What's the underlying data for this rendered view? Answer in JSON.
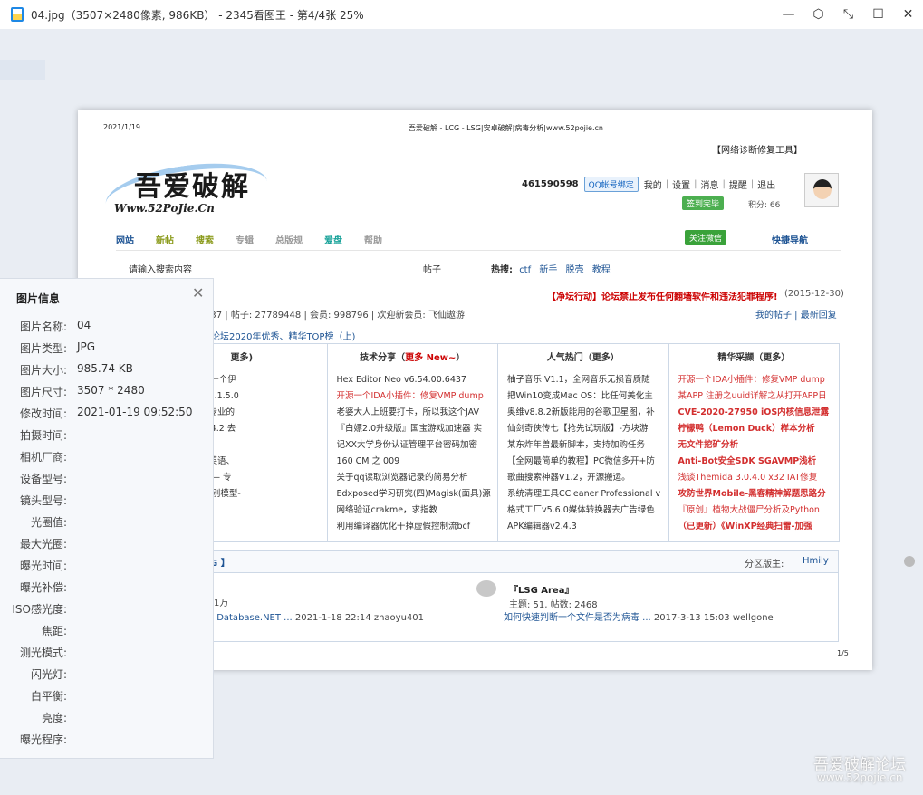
{
  "window": {
    "title": "04.jpg（3507×2480像素, 986KB） - 2345看图王 - 第4/4张 25%",
    "controls": [
      "—",
      "⬡",
      "⤡",
      "☐",
      "✕"
    ]
  },
  "doc": {
    "date": "2021/1/19",
    "header_title": "吾爱破解 - LCG - LSG|安卓破解|病毒分析|www.52pojie.cn",
    "diag_link": "【网络诊断修复工具】",
    "logo_main": "吾爱破解",
    "logo_sub": "Www.52PoJie.Cn",
    "user": {
      "uid": "461590598",
      "qq_bind": "QQ帐号绑定",
      "links": [
        "我的",
        "设置",
        "消息",
        "提醒",
        "退出"
      ],
      "signin": "签到完毕",
      "points": "积分: 66"
    },
    "nav": [
      {
        "label": "网站",
        "color": "#1e5494"
      },
      {
        "label": "新帖",
        "color": "#8a9a1a"
      },
      {
        "label": "搜索",
        "color": "#8a9a1a"
      },
      {
        "label": "专辑",
        "color": "#999999"
      },
      {
        "label": "总版规",
        "color": "#999999"
      },
      {
        "label": "爱盘",
        "color": "#1aa39a"
      },
      {
        "label": "帮助",
        "color": "#999999"
      }
    ],
    "wechat": "关注微信",
    "quicknav": "快捷导航",
    "search": {
      "placeholder": "请输入搜索内容",
      "type": "帖子",
      "hot_label": "热搜:",
      "hot": [
        "ctf",
        "新手",
        "脱壳",
        "教程"
      ]
    },
    "notice": "【净坛行动】论坛禁止发布任何翻墙软件和违法犯罪程序!",
    "notice_date": "(2015-12-30)",
    "stats": "437 | 帖子: 27789448 | 会员: 998796 | 欢迎新会员: 飞仙遨游",
    "my_links": "我的帖子 | 最新回复",
    "top_link": "论坛2020年优秀、精华TOP榜（上)",
    "columns": [
      {
        "head": "更多)",
        "head_more": "",
        "items": [
          {
            "t": "EDEN】(另一个伊",
            "c": ""
          },
          {
            "t": "",
            "c": ""
          },
          {
            "t": "方客户端 V4.1.5.0",
            "c": ""
          },
          {
            "t": "磨皮，超越专业的",
            "c": ""
          },
          {
            "t": "电脑版 6.4.4.2 去",
            "c": ""
          },
          {
            "t": "",
            "c": ""
          },
          {
            "t": "4.00.6437",
            "c": ""
          },
          {
            "t": "去广告——英语、",
            "c": ""
          },
          {
            "t": "去广告版 —— 专",
            "c": ""
          },
          {
            "t": "权器-本地识别模型-",
            "c": ""
          }
        ]
      },
      {
        "head": "技术分享（",
        "head_more": "更多 New~",
        "items": [
          {
            "t": "Hex Editor Neo v6.54.00.6437",
            "c": ""
          },
          {
            "t": "开源一个IDA小插件：修复VMP dump",
            "c": "red"
          },
          {
            "t": "老婆大人上班要打卡，所以我这个JAV",
            "c": ""
          },
          {
            "t": "『白嫖2.0升级版』国宝游戏加速器 实",
            "c": ""
          },
          {
            "t": "记XX大学身份认证管理平台密码加密",
            "c": ""
          },
          {
            "t": "160 CM 之 009",
            "c": ""
          },
          {
            "t": "关于qq读取浏览器记录的简易分析",
            "c": ""
          },
          {
            "t": "Edxposed学习研究(四)Magisk(面具)源",
            "c": ""
          },
          {
            "t": "网络验证crakme，求指教",
            "c": ""
          },
          {
            "t": "利用编译器优化干掉虚假控制流bcf",
            "c": ""
          }
        ]
      },
      {
        "head": "人气热门（更多）",
        "head_more": "",
        "items": [
          {
            "t": "柚子音乐 V1.1，全网音乐无损音质随",
            "c": ""
          },
          {
            "t": "把Win10变成Mac OS：比任何美化主",
            "c": ""
          },
          {
            "t": "奥维v8.8.2新版能用的谷歌卫星图，补",
            "c": ""
          },
          {
            "t": "仙剑奇侠传七【抢先试玩版】-方块游",
            "c": ""
          },
          {
            "t": "某东炸年兽最新脚本，支持加购任务",
            "c": ""
          },
          {
            "t": "【全网最简单的教程】PC微信多开+防",
            "c": ""
          },
          {
            "t": "歌曲搜索神器V1.2，开源搬运。",
            "c": ""
          },
          {
            "t": "系统清理工具CCleaner Professional v",
            "c": ""
          },
          {
            "t": "格式工厂v5.6.0媒体转换器去广告绿色",
            "c": ""
          },
          {
            "t": "APK编辑器v2.4.3",
            "c": ""
          }
        ]
      },
      {
        "head": "精华采撷（更多）",
        "head_more": "",
        "items": [
          {
            "t": "开源一个IDA小插件：修复VMP dump",
            "c": "red"
          },
          {
            "t": "某APP 注册之uuid详解之从打开APP日",
            "c": "red"
          },
          {
            "t": "CVE-2020-27950 iOS内核信息泄露",
            "c": "red bold"
          },
          {
            "t": "柠檬鸭（Lemon Duck）样本分析",
            "c": "red bold"
          },
          {
            "t": "无文件挖矿分析",
            "c": "red bold"
          },
          {
            "t": "Anti-Bot安全SDK SGAVMP浅析",
            "c": "red bold"
          },
          {
            "t": "浅谈Themida 3.0.4.0 x32 IAT修复",
            "c": "red"
          },
          {
            "t": "攻防世界Mobile-黑客精神解题思路分",
            "c": "red bold"
          },
          {
            "t": "『原创』植物大战僵尸分析及Python",
            "c": "red"
          },
          {
            "t": "（已更新）《WinXP经典扫雷-加强",
            "c": "red bold"
          }
        ]
      }
    ],
    "lsg": {
      "title": "G 】",
      "mod_label": "分区版主:",
      "mod_name": "Hmily",
      "wan": "1万",
      "last_left_prefix": "：",
      "last_left_link": "Database.NET ...",
      "last_left_meta": "2021-1-18 22:14 zhaoyu401",
      "area_name": "『LSG Area』",
      "area_stats": "主题: 51, 帖数: 2468",
      "area_last_link": "如何快速判断一个文件是否为病毒 ...",
      "area_last_meta": "2017-3-13 15:03 wellgone"
    },
    "page_num": "1/5"
  },
  "info_panel": {
    "title": "图片信息",
    "rows": [
      {
        "label": "图片名称:",
        "value": "04"
      },
      {
        "label": "图片类型:",
        "value": "JPG"
      },
      {
        "label": "图片大小:",
        "value": "985.74 KB"
      },
      {
        "label": "图片尺寸:",
        "value": "3507 * 2480"
      },
      {
        "label": "修改时间:",
        "value": "2021-01-19 09:52:50"
      },
      {
        "label": "拍摄时间:",
        "value": ""
      },
      {
        "label": "相机厂商:",
        "value": ""
      },
      {
        "label": "设备型号:",
        "value": ""
      },
      {
        "label": "镜头型号:",
        "value": ""
      },
      {
        "label": "光圈值:",
        "value": ""
      },
      {
        "label": "最大光圈:",
        "value": ""
      },
      {
        "label": "曝光时间:",
        "value": ""
      },
      {
        "label": "曝光补偿:",
        "value": ""
      },
      {
        "label": "ISO感光度:",
        "value": ""
      },
      {
        "label": "焦距:",
        "value": ""
      },
      {
        "label": "测光模式:",
        "value": ""
      },
      {
        "label": "闪光灯:",
        "value": ""
      },
      {
        "label": "白平衡:",
        "value": ""
      },
      {
        "label": "亮度:",
        "value": ""
      },
      {
        "label": "曝光程序:",
        "value": ""
      }
    ]
  },
  "watermark": {
    "line1": "吾爱破解论坛",
    "line2": "www.52pojie.cn"
  }
}
